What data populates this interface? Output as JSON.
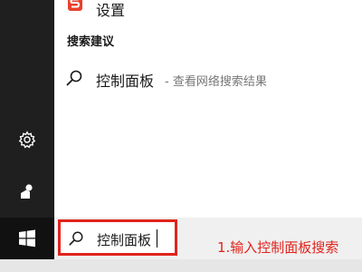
{
  "settings_result": {
    "label": "设置",
    "icon": "settings-app-icon"
  },
  "suggestions": {
    "heading": "搜索建议",
    "items": [
      {
        "main": "控制面板",
        "sub": "- 查看网络搜索结果",
        "icon": "search-icon"
      }
    ]
  },
  "rail": {
    "items": [
      "gear-icon",
      "user-icon",
      "windows-start-icon"
    ]
  },
  "search_box": {
    "value": "控制面板",
    "icon": "search-icon"
  },
  "annotation": {
    "text": "1.输入控制面板搜索"
  },
  "colors": {
    "rail": "#1f1f1f",
    "highlight": "#e0231c",
    "accent_brand": "#e8412e"
  }
}
